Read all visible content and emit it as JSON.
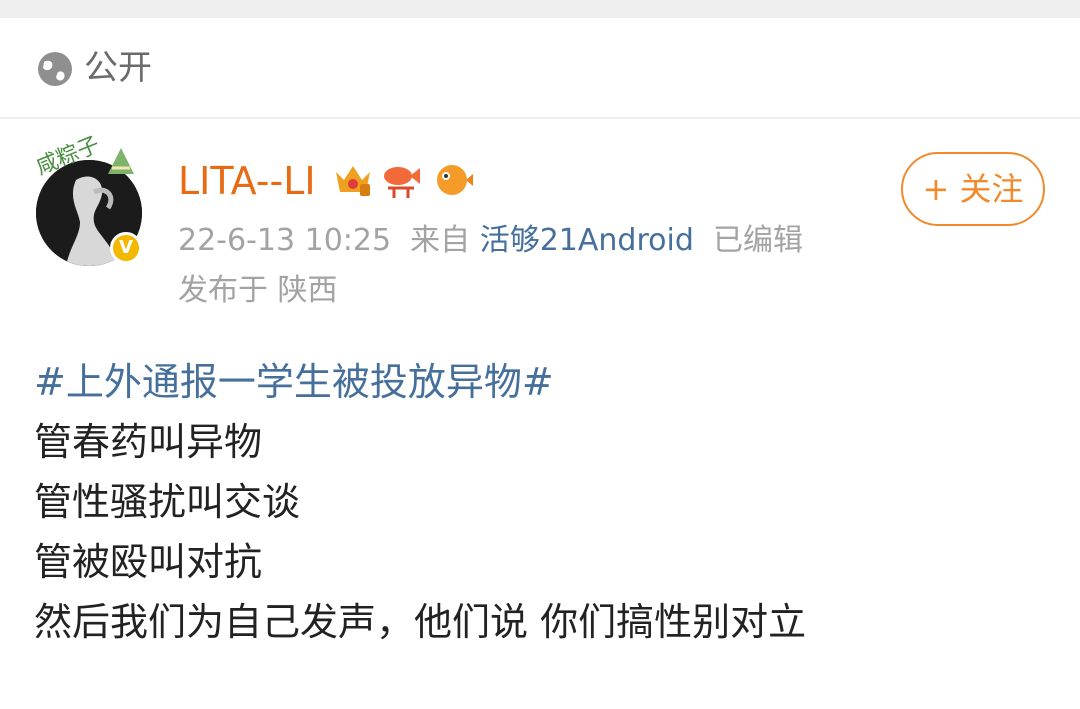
{
  "visibility": {
    "icon": "globe-icon",
    "label": "公开"
  },
  "post": {
    "author": {
      "name": "LITA--LI",
      "avatar_frame_text": "咸粽子",
      "verified_icon": "verified-v-icon",
      "badges": [
        "crown-badge-icon",
        "koi-fish-badge-icon",
        "puffer-fish-badge-icon"
      ]
    },
    "meta": {
      "time": "22-6-13 10:25",
      "from_label": "来自",
      "source": "活够21Android",
      "edited": "已编辑",
      "location": "发布于 陕西"
    },
    "follow_label": "+ 关注",
    "content": {
      "hashtag": "#上外通报一学生被投放异物#",
      "lines": [
        "管春药叫异物",
        "管性骚扰叫交谈",
        "管被殴叫对抗",
        "然后我们为自己发声，他们说 你们搞性别对立"
      ]
    }
  },
  "colors": {
    "username": "#e86a12",
    "link": "#46709b",
    "follow": "#f28a2c",
    "meta": "#a3a3a3",
    "verified": "#f5b800"
  }
}
